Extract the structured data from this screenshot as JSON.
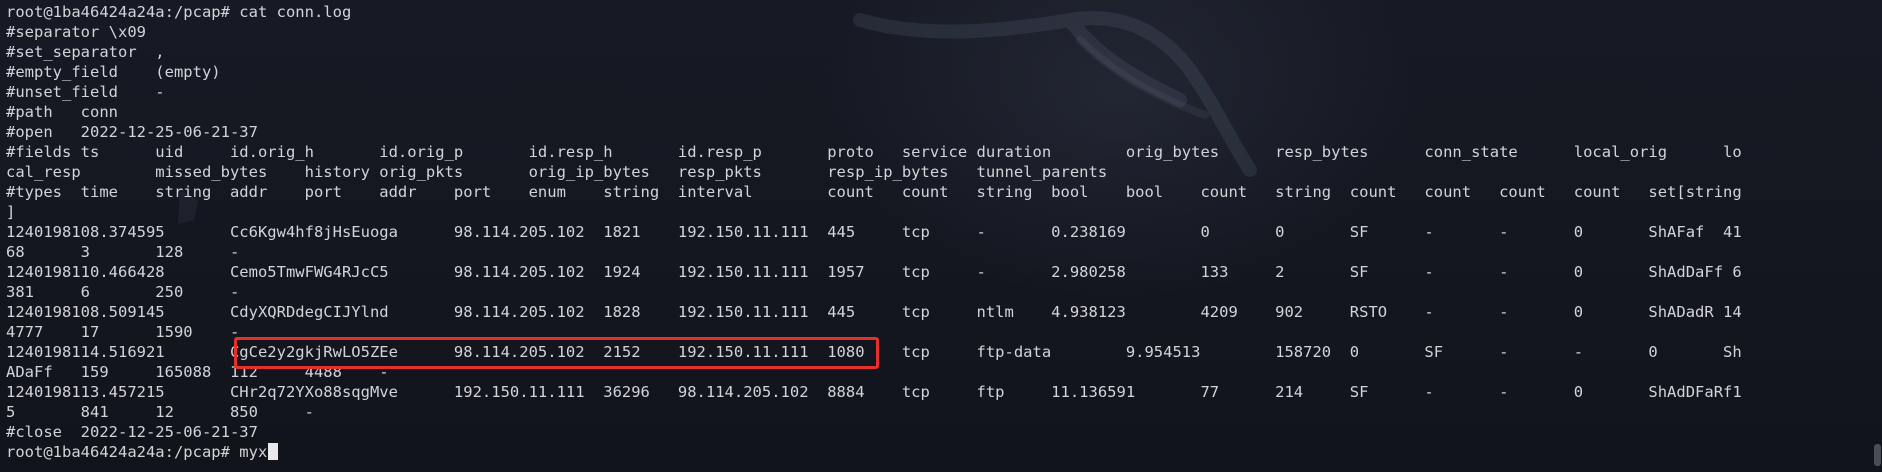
{
  "terminal": {
    "lines": [
      "root@1ba46424a24a:/pcap# cat conn.log",
      "#separator \\x09",
      "#set_separator  ,",
      "#empty_field    (empty)",
      "#unset_field    -",
      "#path   conn",
      "#open   2022-12-25-06-21-37",
      "#fields ts      uid     id.orig_h       id.orig_p       id.resp_h       id.resp_p       proto   service duration        orig_bytes      resp_bytes      conn_state      local_orig      lo",
      "cal_resp        missed_bytes    history orig_pkts       orig_ip_bytes   resp_pkts       resp_ip_bytes   tunnel_parents",
      "#types  time    string  addr    port    addr    port    enum    string  interval        count   count   string  bool    bool    count   string  count   count   count   count   set[string",
      "]",
      "1240198108.374595       Cc6Kgw4hf8jHsEuoga      98.114.205.102  1821    192.150.11.111  445     tcp     -       0.238169        0       0       SF      -       -       0       ShAFaf  41",
      "68      3       128     -",
      "1240198110.466428       Cemo5TmwFWG4RJcC5       98.114.205.102  1924    192.150.11.111  1957    tcp     -       2.980258        133     2       SF      -       -       0       ShAdDaFf 6",
      "381     6       250     -",
      "1240198108.509145       CdyXQRDdegCIJYlnd       98.114.205.102  1828    192.150.11.111  445     tcp     ntlm    4.938123        4209    902     RSTO    -       -       0       ShADadR 14",
      "4777    17      1590    -",
      "1240198114.516921       CgCe2y2gkjRwLO5ZEe      98.114.205.102  2152    192.150.11.111  1080    tcp     ftp-data        9.954513        158720  0       SF      -       -       0       Sh",
      "ADaFf   159     165088  112     4488    -",
      "1240198113.457215       CHr2q72YXo88sqgMve      192.150.11.111  36296   98.114.205.102  8884    tcp     ftp     11.136591       77      214     SF      -       -       0       ShAdDFaRf1",
      "5       841     12      850     -",
      "#close  2022-12-25-06-21-37",
      "root@1ba46424a24a:/pcap# myx"
    ],
    "highlight_color": "#e5302b",
    "text_color": "#d2d4d8",
    "background_color": "#14161f"
  }
}
